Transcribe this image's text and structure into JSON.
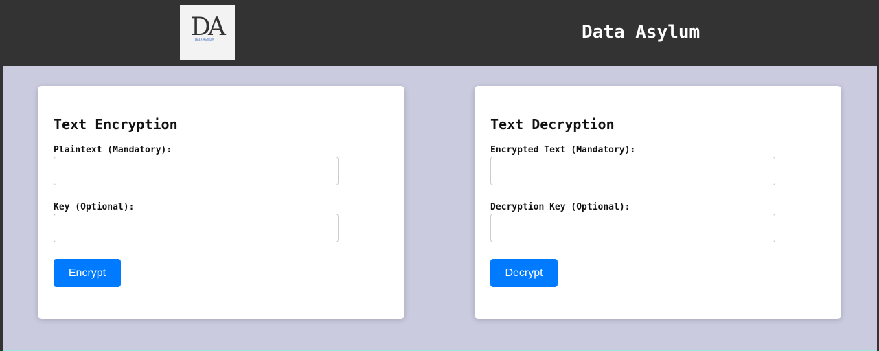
{
  "header": {
    "logo_text": "DA",
    "logo_subtext": "DATA ASYLUM",
    "title": "Data Asylum"
  },
  "encryption": {
    "heading": "Text Encryption",
    "plaintext_label": "Plaintext (Mandatory):",
    "plaintext_value": "",
    "key_label": "Key (Optional):",
    "key_value": "",
    "button": "Encrypt"
  },
  "decryption": {
    "heading": "Text Decryption",
    "ciphertext_label": "Encrypted Text (Mandatory):",
    "ciphertext_value": "",
    "key_label": "Decryption Key (Optional):",
    "key_value": "",
    "button": "Decrypt"
  },
  "colors": {
    "header": "#333333",
    "background": "#cacbdf",
    "button": "#007bff"
  }
}
